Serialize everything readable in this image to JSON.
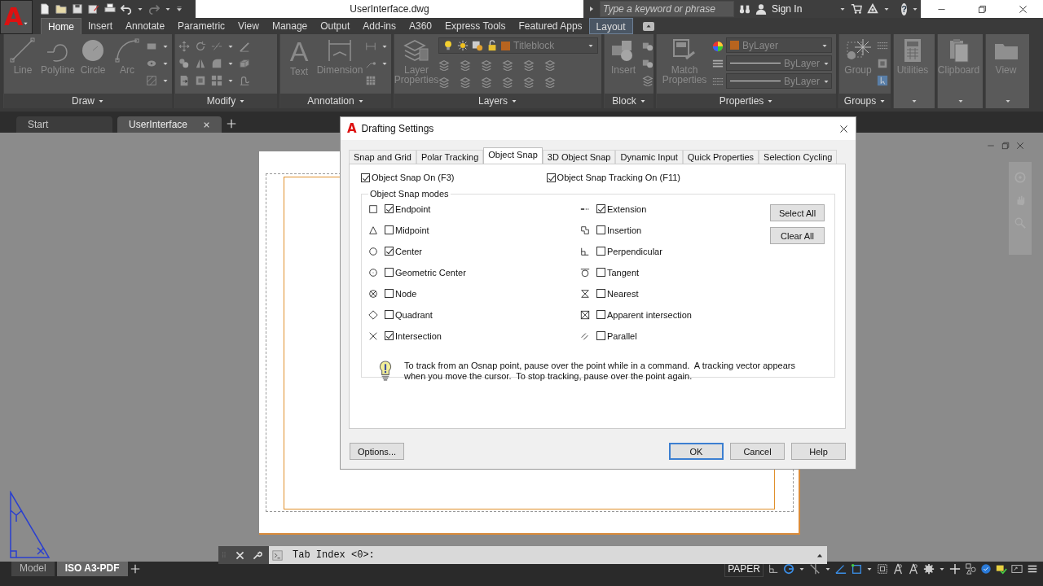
{
  "logo": "A",
  "title": "UserInterface.dwg",
  "search": {
    "placeholder": "Type a keyword or phrase"
  },
  "account": {
    "label": "Sign In"
  },
  "help": "?",
  "ribbon_tabs": [
    {
      "label": "Home",
      "selected": true,
      "kind": "standard"
    },
    {
      "label": "Insert",
      "selected": false,
      "kind": "standard"
    },
    {
      "label": "Annotate",
      "selected": false,
      "kind": "standard"
    },
    {
      "label": "Parametric",
      "selected": false,
      "kind": "standard"
    },
    {
      "label": "View",
      "selected": false,
      "kind": "standard"
    },
    {
      "label": "Manage",
      "selected": false,
      "kind": "standard"
    },
    {
      "label": "Output",
      "selected": false,
      "kind": "standard"
    },
    {
      "label": "Add-ins",
      "selected": false,
      "kind": "standard"
    },
    {
      "label": "A360",
      "selected": false,
      "kind": "standard"
    },
    {
      "label": "Express Tools",
      "selected": false,
      "kind": "standard"
    },
    {
      "label": "Featured Apps",
      "selected": false,
      "kind": "standard"
    },
    {
      "label": "Layout",
      "selected": false,
      "kind": "contextual"
    }
  ],
  "panels": [
    {
      "title": "Draw",
      "tools": [
        {
          "label": "Line"
        },
        {
          "label": "Polyline"
        },
        {
          "label": "Circle"
        },
        {
          "label": "Arc"
        }
      ]
    },
    {
      "title": "Modify"
    },
    {
      "title": "Annotation",
      "tools": [
        {
          "label": "Text",
          "glyph": "A"
        },
        {
          "label": "Dimension"
        }
      ]
    },
    {
      "title": "Layers",
      "tools": [
        {
          "label": "Layer Properties"
        }
      ],
      "dropdowns": [
        "Titleblock"
      ]
    },
    {
      "title": "Block",
      "tools": [
        {
          "label": "Insert"
        }
      ]
    },
    {
      "title": "Properties",
      "tools": [
        {
          "label": "Match Properties"
        }
      ],
      "dropdowns": [
        "ByLayer",
        "ByLayer",
        "ByLayer"
      ]
    },
    {
      "title": "Groups",
      "tools": [
        {
          "label": "Group"
        }
      ]
    },
    {
      "tools": [
        {
          "label": "Utilities"
        }
      ]
    },
    {
      "tools": [
        {
          "label": "Clipboard"
        }
      ]
    },
    {
      "tools": [
        {
          "label": "View"
        }
      ]
    }
  ],
  "doc_tabs": [
    {
      "label": "Start",
      "selected": false
    },
    {
      "label": "UserInterface",
      "selected": true
    }
  ],
  "dialog": {
    "logo": "A",
    "title": "Drafting Settings",
    "tabs": [
      {
        "label": "Snap and Grid",
        "selected": false
      },
      {
        "label": "Polar Tracking",
        "selected": false
      },
      {
        "label": "Object Snap",
        "selected": true
      },
      {
        "label": "3D Object Snap",
        "selected": false
      },
      {
        "label": "Dynamic Input",
        "selected": false
      },
      {
        "label": "Quick Properties",
        "selected": false
      },
      {
        "label": "Selection Cycling",
        "selected": false
      }
    ],
    "snap_on": {
      "label": "Object Snap On (F3)",
      "checked": true
    },
    "tracking_on": {
      "label": "Object Snap Tracking On (F11)",
      "checked": true
    },
    "modes_title": "Object Snap modes",
    "modes": [
      {
        "kind": "endpoint",
        "label": "Endpoint",
        "checked": true
      },
      {
        "kind": "midpoint",
        "label": "Midpoint",
        "checked": false
      },
      {
        "kind": "center",
        "label": "Center",
        "checked": true
      },
      {
        "kind": "geometric_center",
        "label": "Geometric Center",
        "checked": false
      },
      {
        "kind": "node",
        "label": "Node",
        "checked": false
      },
      {
        "kind": "quadrant",
        "label": "Quadrant",
        "checked": false
      },
      {
        "kind": "intersection",
        "label": "Intersection",
        "checked": true
      },
      {
        "kind": "extension",
        "label": "Extension",
        "checked": true
      },
      {
        "kind": "insertion",
        "label": "Insertion",
        "checked": false
      },
      {
        "kind": "perpendicular",
        "label": "Perpendicular",
        "checked": false
      },
      {
        "kind": "tangent",
        "label": "Tangent",
        "checked": false
      },
      {
        "kind": "nearest",
        "label": "Nearest",
        "checked": false
      },
      {
        "kind": "apparent",
        "label": "Apparent intersection",
        "checked": false
      },
      {
        "kind": "parallel",
        "label": "Parallel",
        "checked": false
      }
    ],
    "mode_buttons": [
      "Select All",
      "Clear All"
    ],
    "tip": "To track from an Osnap point, pause over the point while in a command.  A tracking vector appears when you move the cursor.  To stop tracking, pause over the point again.",
    "buttons": [
      {
        "label": "Options...",
        "kind": "left"
      },
      {
        "label": "OK",
        "kind": "default"
      },
      {
        "label": "Cancel",
        "kind": "normal"
      },
      {
        "label": "Help",
        "kind": "normal"
      }
    ]
  },
  "command_line": {
    "prompt": "Tab Index <0>:"
  },
  "layout_tabs": [
    {
      "label": "Model",
      "selected": false
    },
    {
      "label": "ISO A3-PDF",
      "selected": true
    }
  ],
  "status_bar": {
    "space": "PAPER"
  }
}
